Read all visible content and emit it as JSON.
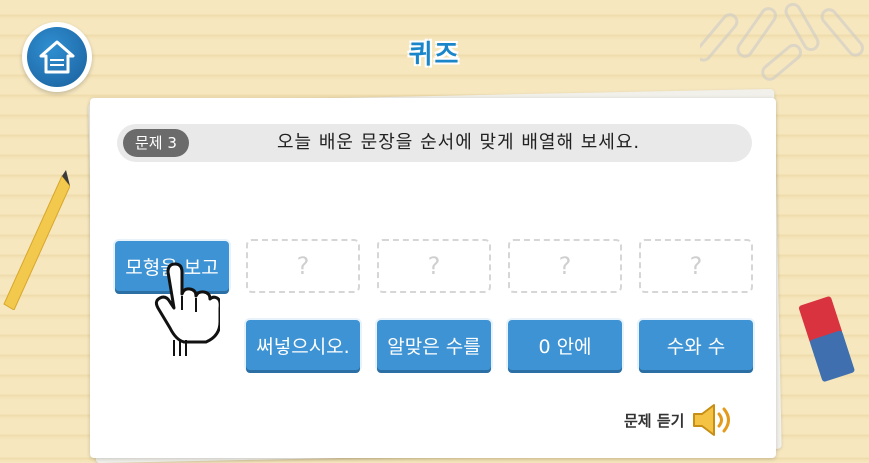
{
  "header": {
    "title": "퀴즈"
  },
  "question": {
    "number_label": "문제 3",
    "prompt": "오늘 배운 문장을 순서에 맞게 배열해 보세요."
  },
  "placed_words": [
    "모형을 보고"
  ],
  "slots": [
    "?",
    "?",
    "?",
    "?"
  ],
  "word_choices": [
    "써넣으시오.",
    "알맞은 수를",
    "0 안에",
    "수와 수"
  ],
  "listen": {
    "label": "문제 듣기"
  },
  "colors": {
    "accent": "#3d93d3",
    "title": "#1a86c9"
  },
  "icons": {
    "home": "home-icon",
    "speaker": "speaker-icon",
    "hand": "hand-pointer-icon",
    "pencil": "pencil-icon",
    "eraser": "eraser-icon",
    "paperclips": "paperclip-icon"
  }
}
